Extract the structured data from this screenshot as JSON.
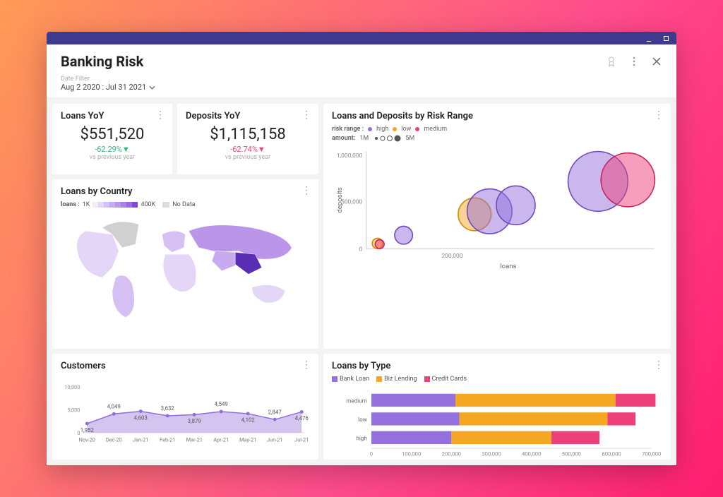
{
  "header": {
    "title": "Banking Risk",
    "date_filter_label": "Date Filter",
    "date_filter_value": "Aug 2 2020 : Jul 31 2021"
  },
  "kpi_loans": {
    "title": "Loans YoY",
    "value": "$551,520",
    "pct": "-62.29%",
    "direction": "down",
    "color": "pos",
    "compare": "vs previous year"
  },
  "kpi_deposits": {
    "title": "Deposits YoY",
    "value": "$1,115,158",
    "pct": "-62.74%",
    "direction": "down",
    "color": "neg",
    "compare": "vs previous year"
  },
  "map": {
    "title": "Loans by Country",
    "legend_label": "loans :",
    "min": "1K",
    "max": "400K",
    "nodata": "No Data",
    "gradient": [
      "#f1ebfb",
      "#e4d6f7",
      "#d6c0f3",
      "#c8aaee",
      "#ba95ea",
      "#ac7fe6",
      "#9e69e2",
      "#8047d9"
    ]
  },
  "bubble": {
    "title": "Loans and Deposits by Risk Range",
    "legend_risk_label": "risk range :",
    "legend_risk": [
      {
        "name": "high",
        "color": "#9370DB"
      },
      {
        "name": "low",
        "color": "#f5a623"
      },
      {
        "name": "medium",
        "color": "#ec407a"
      }
    ],
    "legend_amount_label": "amount:",
    "legend_amount": [
      "1M",
      "5M"
    ],
    "xlabel": "loans",
    "ylabel": "deposits",
    "xtick": "200,000",
    "ytick1": "500,000",
    "ytick2": "1,000,000"
  },
  "customers": {
    "title": "Customers",
    "yticks": [
      "0",
      "5,000",
      "10,000"
    ]
  },
  "loans_type": {
    "title": "Loans by Type",
    "legend": [
      {
        "name": "Bank Loan",
        "color": "#9370DB"
      },
      {
        "name": "Biz Lending",
        "color": "#f5a623"
      },
      {
        "name": "Credit Cards",
        "color": "#ec407a"
      }
    ],
    "xticks": [
      "0",
      "100,000",
      "200,000",
      "300,000",
      "400,000",
      "500,000",
      "600,000",
      "700,000"
    ]
  },
  "chart_data": [
    {
      "type": "scatter",
      "id": "loans_deposits_by_risk",
      "title": "Loans and Deposits by Risk Range",
      "xlabel": "loans",
      "ylabel": "deposits",
      "xlim": [
        0,
        700000
      ],
      "ylim": [
        0,
        1000000
      ],
      "series": [
        {
          "name": "high",
          "points": [
            {
              "x": 60000,
              "y": 130000,
              "size": 1000000
            },
            {
              "x": 260000,
              "y": 380000,
              "size": 3500000
            },
            {
              "x": 300000,
              "y": 430000,
              "size": 2800000
            },
            {
              "x": 530000,
              "y": 730000,
              "size": 4800000
            }
          ]
        },
        {
          "name": "low",
          "points": [
            {
              "x": 25000,
              "y": 60000,
              "size": 800000
            },
            {
              "x": 230000,
              "y": 360000,
              "size": 2200000
            }
          ]
        },
        {
          "name": "medium",
          "points": [
            {
              "x": 28000,
              "y": 55000,
              "size": 700000
            },
            {
              "x": 590000,
              "y": 740000,
              "size": 4200000
            }
          ]
        }
      ]
    },
    {
      "type": "line",
      "id": "customers",
      "title": "Customers",
      "categories": [
        "Nov-20",
        "Dec-20",
        "Jan-21",
        "Feb-21",
        "Mar-21",
        "Apr-21",
        "May-21",
        "Jun-21",
        "Jul-21"
      ],
      "values": [
        1952,
        4049,
        4603,
        3632,
        3879,
        4549,
        4102,
        2847,
        4476
      ],
      "ylim": [
        0,
        10000
      ]
    },
    {
      "type": "bar",
      "id": "loans_by_type",
      "orientation": "horizontal",
      "stacked": true,
      "title": "Loans by Type",
      "categories": [
        "medium",
        "low",
        "high"
      ],
      "series": [
        {
          "name": "Bank Loan",
          "values": [
            210000,
            220000,
            200000
          ]
        },
        {
          "name": "Biz Lending",
          "values": [
            400000,
            370000,
            250000
          ]
        },
        {
          "name": "Credit Cards",
          "values": [
            100000,
            70000,
            120000
          ]
        }
      ],
      "xlim": [
        0,
        700000
      ]
    }
  ]
}
